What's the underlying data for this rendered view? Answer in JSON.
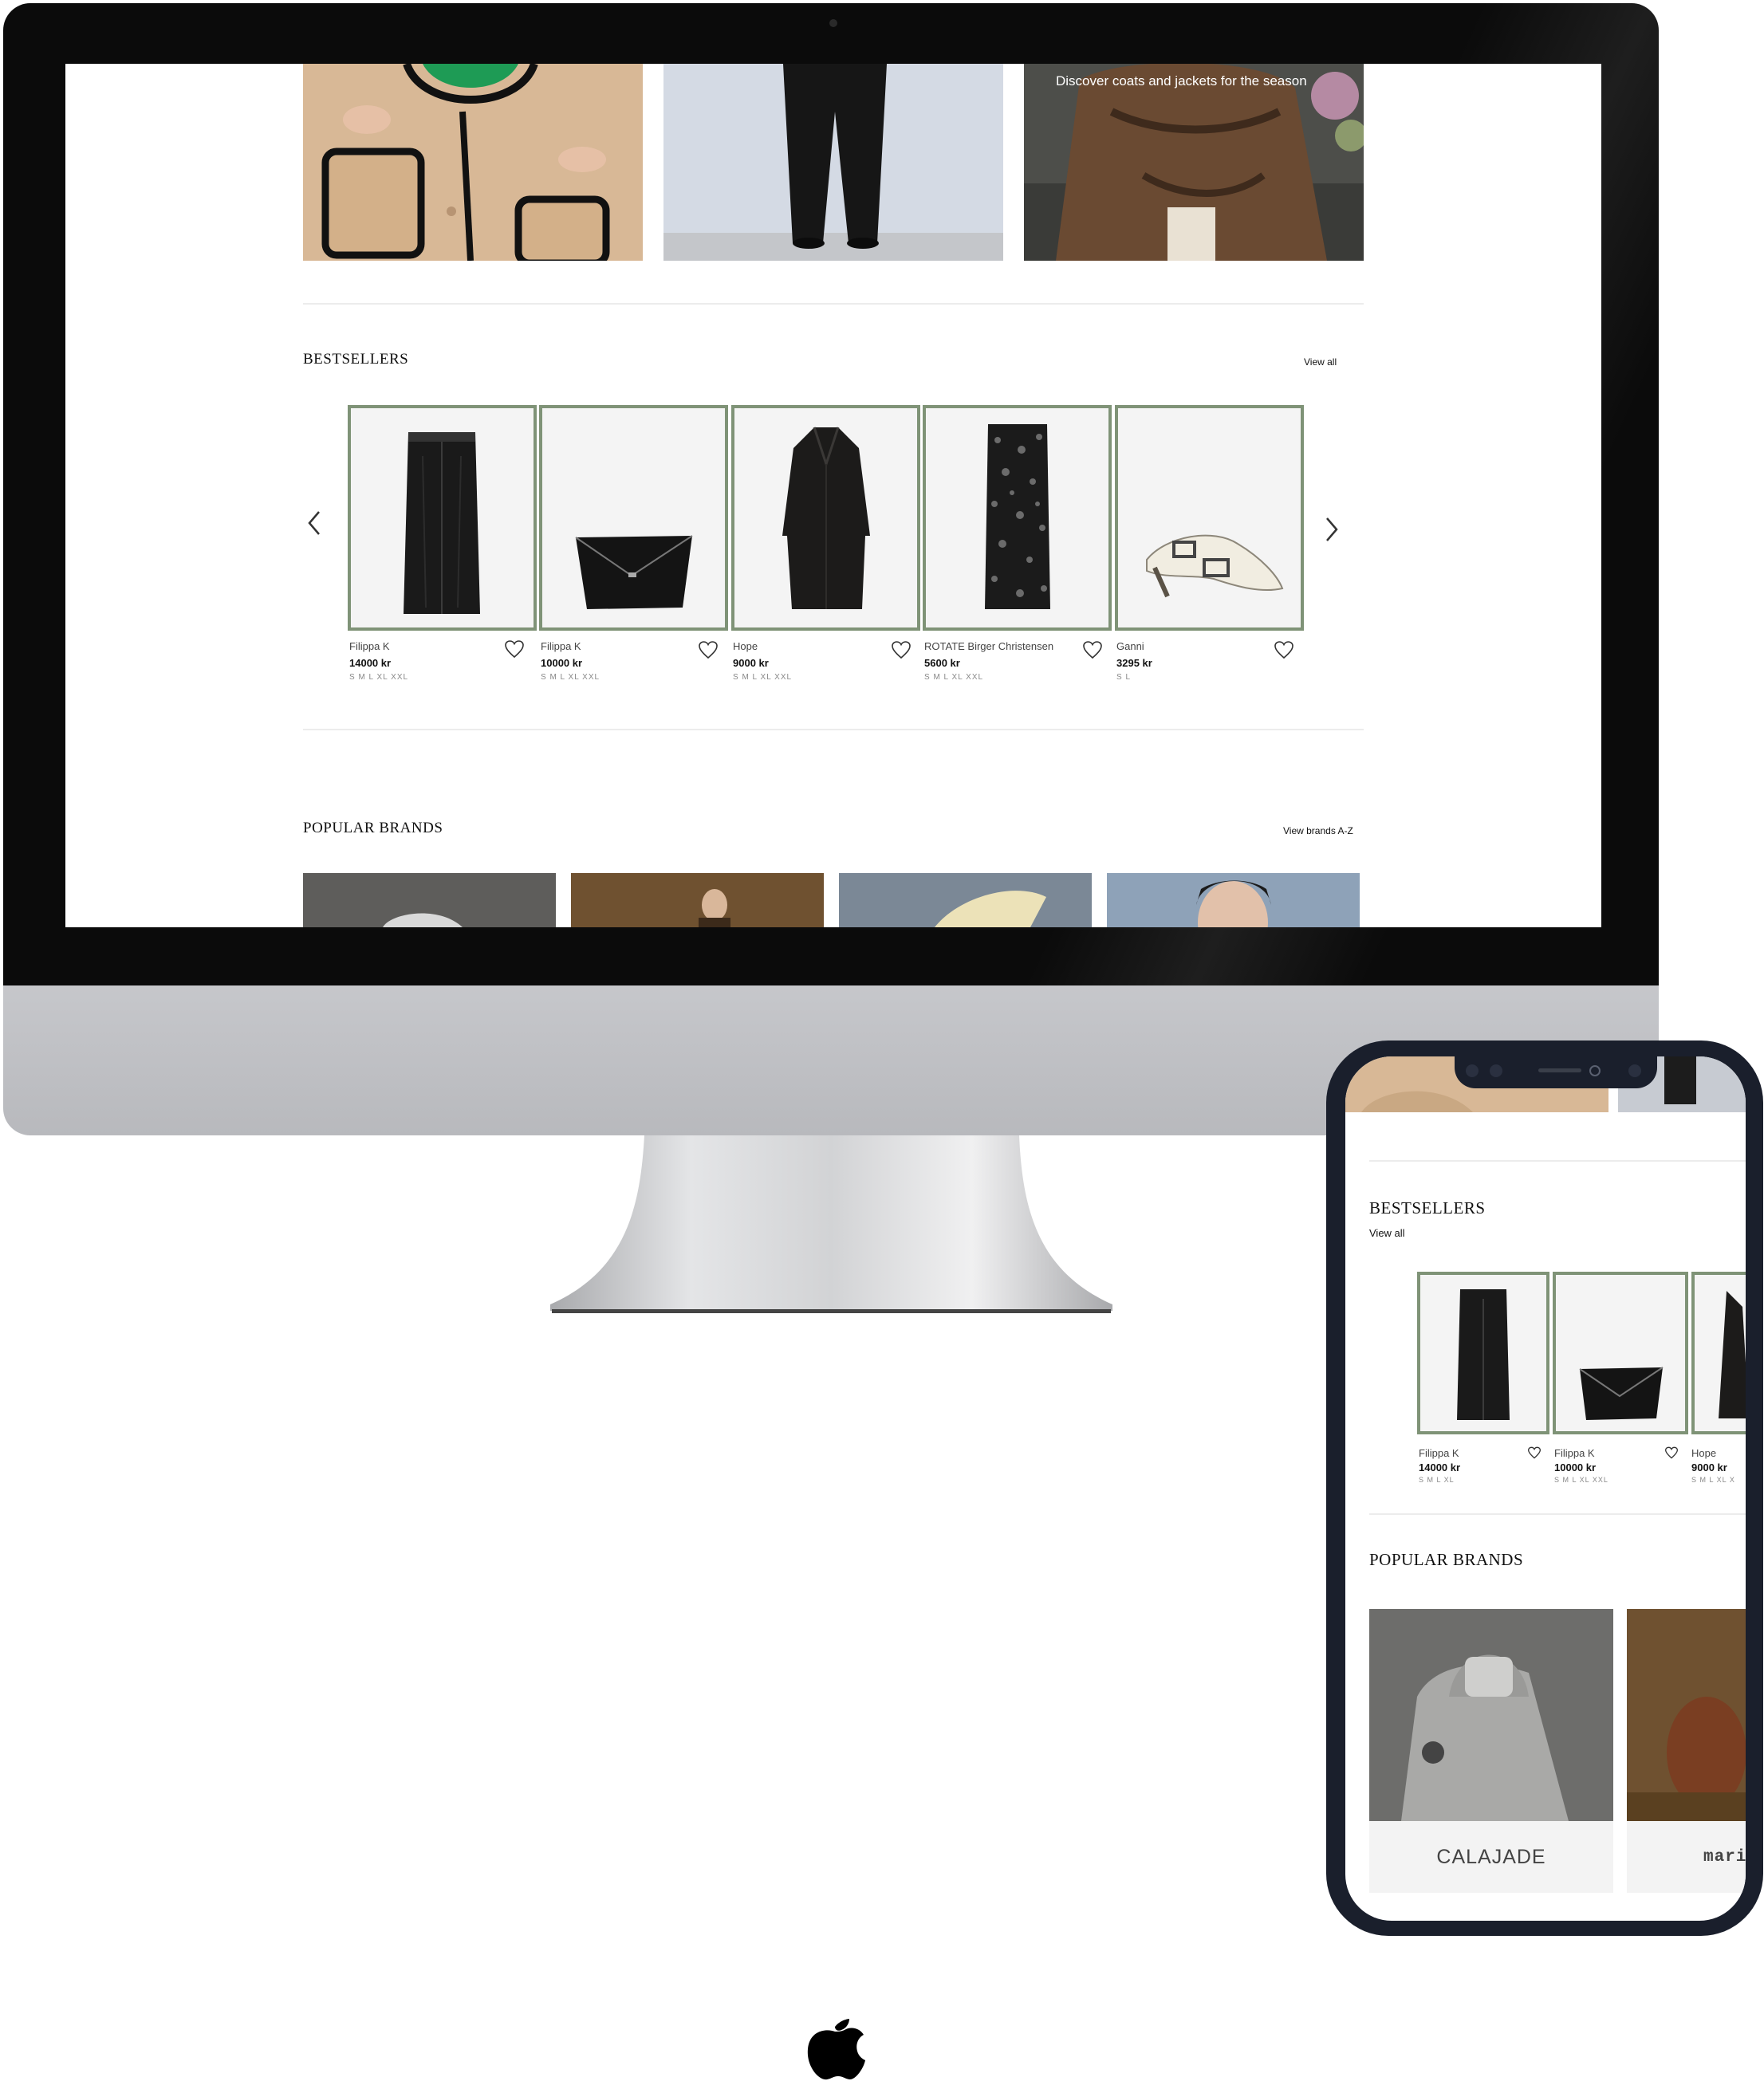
{
  "hero": {
    "caption": "Discover coats and jackets for the season"
  },
  "bestsellers": {
    "title": "BESTSELLERS",
    "view_all": "View all",
    "products": [
      {
        "brand": "Filippa K",
        "price": "14000 kr",
        "sizes": "S M L XL XXL",
        "icon": "leather-skirt"
      },
      {
        "brand": "Filippa K",
        "price": "10000 kr",
        "sizes": "S M L XL XXL",
        "icon": "clutch-bag"
      },
      {
        "brand": "Hope",
        "price": "9000 kr",
        "sizes": "S M L XL XXL",
        "icon": "long-coat"
      },
      {
        "brand": "ROTATE Birger Christensen",
        "price": "5600 kr",
        "sizes": "S M L XL XXL",
        "icon": "sequin-dress"
      },
      {
        "brand": "Ganni",
        "price": "3295 kr",
        "sizes": "S L",
        "icon": "buckle-flat"
      }
    ]
  },
  "popular_brands": {
    "title": "POPULAR BRANDS",
    "view_brands": "View brands A-Z"
  },
  "mobile": {
    "bestsellers_title": "BESTSELLERS",
    "view_all": "View all",
    "products": [
      {
        "brand": "Filippa K",
        "price": "14000 kr",
        "sizes": "S M L XL"
      },
      {
        "brand": "Filippa K",
        "price": "10000 kr",
        "sizes": "S M L XL XXL"
      },
      {
        "brand": "Hope",
        "price": "9000 kr",
        "sizes": "S M L XL X"
      }
    ],
    "popular_brands_title": "POPULAR BRANDS",
    "brand_cards": [
      {
        "label": "CALAJADE"
      },
      {
        "label": "marin"
      }
    ]
  },
  "colors": {
    "accent_border": "#7f9377",
    "device_dark": "#0b0b0b",
    "device_silver": "#c6c7cb"
  }
}
